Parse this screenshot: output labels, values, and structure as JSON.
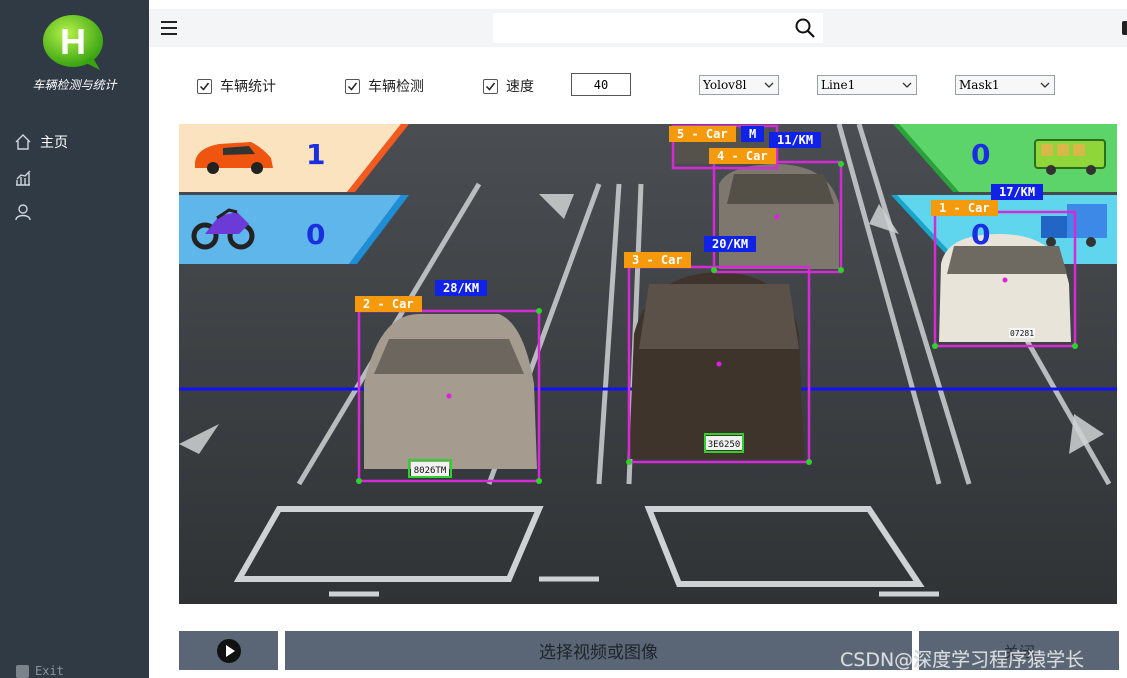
{
  "sidebar": {
    "logo_letter": "H",
    "logo_text": "车辆检测与统计",
    "items": [
      {
        "label": "主页",
        "icon": "home-icon"
      },
      {
        "label": "",
        "icon": "chart-icon"
      },
      {
        "label": "",
        "icon": "user-icon"
      }
    ],
    "exit_label": "Exit"
  },
  "topbar": {
    "search_value": "",
    "search_icon": "search-icon",
    "menu_icon": "hamburger-icon"
  },
  "controls": {
    "vehicle_count": {
      "label": "车辆统计",
      "checked": true
    },
    "vehicle_detect": {
      "label": "车辆检测",
      "checked": true
    },
    "speed": {
      "label": "速度",
      "checked": true
    },
    "speed_value": "40",
    "model_select": "Yolov8l",
    "line_select": "Line1",
    "mask_select": "Mask1"
  },
  "video": {
    "counters": {
      "car": "1",
      "motorcycle": "0",
      "bus": "0",
      "truck": "0"
    },
    "detections": [
      {
        "class_label": "1 - Car",
        "speed_label": "17/KM"
      },
      {
        "class_label": "2 - Car",
        "speed_label": "28/KM"
      },
      {
        "class_label": "3 - Car",
        "speed_label": "20/KM"
      },
      {
        "class_label": "4 - Car",
        "speed_label": "11/KM"
      },
      {
        "class_label": "5 - Car",
        "speed_label": "M"
      }
    ],
    "plates": [
      "8026TM",
      "3E6250",
      "07281"
    ]
  },
  "bottom": {
    "select_label": "选择视频或图像",
    "close_label": "关闭"
  },
  "watermark": "CSDN@深度学习程序猿学长",
  "colors": {
    "sidebar_bg": "#2f3a45",
    "button_bg": "#5a6675",
    "box_color": "#d42bd6",
    "class_label_bg": "#f59a0c",
    "speed_label_bg": "#1122e8",
    "count_line": "#1111ff"
  }
}
